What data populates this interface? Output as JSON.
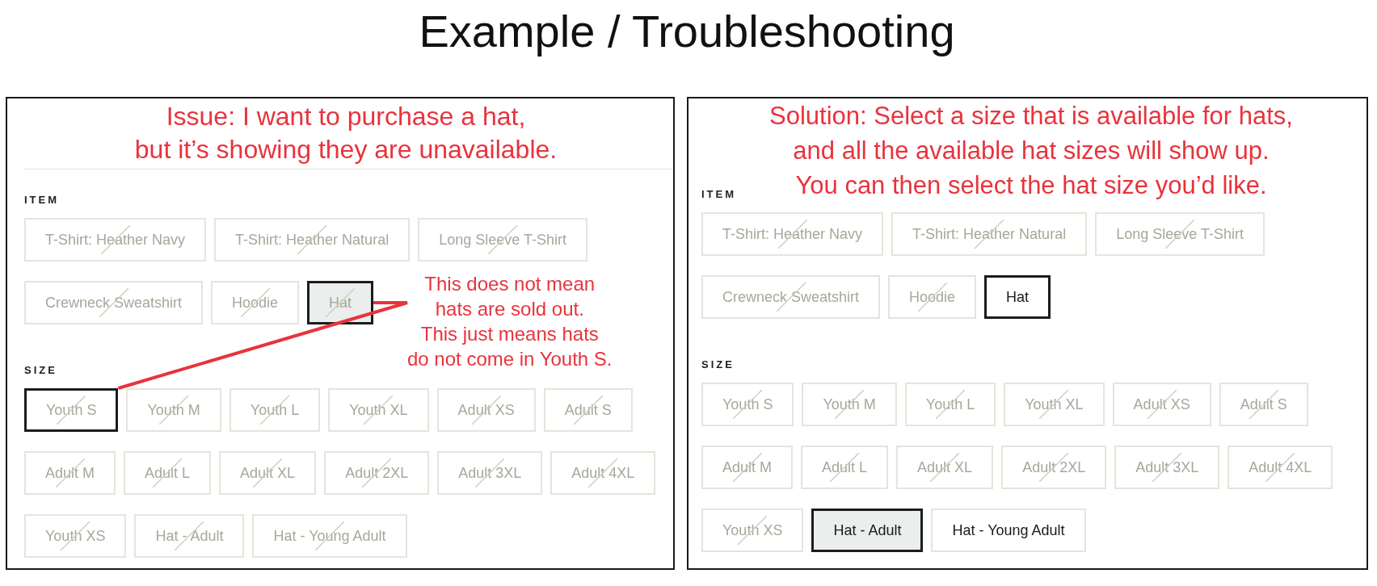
{
  "title": "Example / Troubleshooting",
  "panels": [
    {
      "kind": "issue",
      "message": "Issue: I want to purchase a hat,\nbut it’s showing they are unavailable.",
      "note": "This does not mean\nhats are sold out.\nThis just means hats\ndo not come in Youth S.",
      "item_label": "ITEM",
      "items": [
        {
          "label": "T-Shirt: Heather Navy",
          "available": false,
          "selected": false,
          "hovered": false
        },
        {
          "label": "T-Shirt: Heather Natural",
          "available": false,
          "selected": false,
          "hovered": false
        },
        {
          "label": "Long Sleeve T-Shirt",
          "available": false,
          "selected": false,
          "hovered": false
        },
        {
          "label": "Crewneck Sweatshirt",
          "available": false,
          "selected": false,
          "hovered": false
        },
        {
          "label": "Hoodie",
          "available": false,
          "selected": false,
          "hovered": false
        },
        {
          "label": "Hat",
          "available": false,
          "selected": true,
          "hovered": true
        }
      ],
      "size_label": "SIZE",
      "sizes": [
        {
          "label": "Youth S",
          "available": false,
          "selected": true,
          "hovered": false
        },
        {
          "label": "Youth M",
          "available": false,
          "selected": false,
          "hovered": false
        },
        {
          "label": "Youth L",
          "available": false,
          "selected": false,
          "hovered": false
        },
        {
          "label": "Youth XL",
          "available": false,
          "selected": false,
          "hovered": false
        },
        {
          "label": "Adult XS",
          "available": false,
          "selected": false,
          "hovered": false
        },
        {
          "label": "Adult S",
          "available": false,
          "selected": false,
          "hovered": false
        },
        {
          "label": "Adult M",
          "available": false,
          "selected": false,
          "hovered": false
        },
        {
          "label": "Adult L",
          "available": false,
          "selected": false,
          "hovered": false
        },
        {
          "label": "Adult XL",
          "available": false,
          "selected": false,
          "hovered": false
        },
        {
          "label": "Adult 2XL",
          "available": false,
          "selected": false,
          "hovered": false
        },
        {
          "label": "Adult 3XL",
          "available": false,
          "selected": false,
          "hovered": false
        },
        {
          "label": "Adult 4XL",
          "available": false,
          "selected": false,
          "hovered": false
        },
        {
          "label": "Youth XS",
          "available": false,
          "selected": false,
          "hovered": false
        },
        {
          "label": "Hat - Adult",
          "available": false,
          "selected": false,
          "hovered": false
        },
        {
          "label": "Hat - Young Adult",
          "available": false,
          "selected": false,
          "hovered": false
        }
      ]
    },
    {
      "kind": "solution",
      "message": "Solution: Select a size that is available for hats,\nand all the available hat sizes will show up.\nYou can then select the hat size you’d like.",
      "item_label": "ITEM",
      "items": [
        {
          "label": "T-Shirt: Heather Navy",
          "available": false,
          "selected": false,
          "hovered": false
        },
        {
          "label": "T-Shirt: Heather Natural",
          "available": false,
          "selected": false,
          "hovered": false
        },
        {
          "label": "Long Sleeve T-Shirt",
          "available": false,
          "selected": false,
          "hovered": false
        },
        {
          "label": "Crewneck Sweatshirt",
          "available": false,
          "selected": false,
          "hovered": false
        },
        {
          "label": "Hoodie",
          "available": false,
          "selected": false,
          "hovered": false
        },
        {
          "label": "Hat",
          "available": true,
          "selected": true,
          "hovered": false
        }
      ],
      "size_label": "SIZE",
      "sizes": [
        {
          "label": "Youth S",
          "available": false,
          "selected": false,
          "hovered": false
        },
        {
          "label": "Youth M",
          "available": false,
          "selected": false,
          "hovered": false
        },
        {
          "label": "Youth L",
          "available": false,
          "selected": false,
          "hovered": false
        },
        {
          "label": "Youth XL",
          "available": false,
          "selected": false,
          "hovered": false
        },
        {
          "label": "Adult XS",
          "available": false,
          "selected": false,
          "hovered": false
        },
        {
          "label": "Adult S",
          "available": false,
          "selected": false,
          "hovered": false
        },
        {
          "label": "Adult M",
          "available": false,
          "selected": false,
          "hovered": false
        },
        {
          "label": "Adult L",
          "available": false,
          "selected": false,
          "hovered": false
        },
        {
          "label": "Adult XL",
          "available": false,
          "selected": false,
          "hovered": false
        },
        {
          "label": "Adult 2XL",
          "available": false,
          "selected": false,
          "hovered": false
        },
        {
          "label": "Adult 3XL",
          "available": false,
          "selected": false,
          "hovered": false
        },
        {
          "label": "Adult 4XL",
          "available": false,
          "selected": false,
          "hovered": false
        },
        {
          "label": "Youth XS",
          "available": false,
          "selected": false,
          "hovered": false
        },
        {
          "label": "Hat - Adult",
          "available": true,
          "selected": true,
          "hovered": true
        },
        {
          "label": "Hat - Young Adult",
          "available": true,
          "selected": false,
          "hovered": false
        }
      ]
    }
  ]
}
